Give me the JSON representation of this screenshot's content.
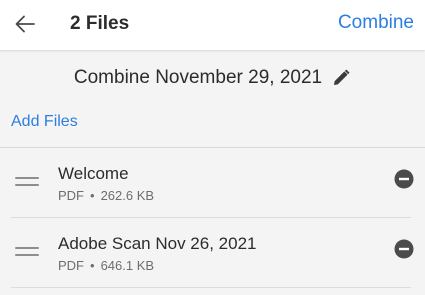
{
  "header": {
    "title": "2 Files",
    "action_label": "Combine",
    "back_icon": "arrow-left-icon"
  },
  "document": {
    "name": "Combine November 29, 2021",
    "edit_icon": "pencil-icon"
  },
  "add_files_label": "Add Files",
  "files": [
    {
      "name": "Welcome",
      "type": "PDF",
      "separator": "•",
      "size": "262.6 KB"
    },
    {
      "name": "Adobe Scan Nov 26, 2021",
      "type": "PDF",
      "separator": "•",
      "size": "646.1 KB"
    }
  ],
  "colors": {
    "accent": "#2d7ee0",
    "background": "#f4f4f4",
    "text": "#2c2c2c",
    "secondary_text": "#6e6e6e"
  }
}
